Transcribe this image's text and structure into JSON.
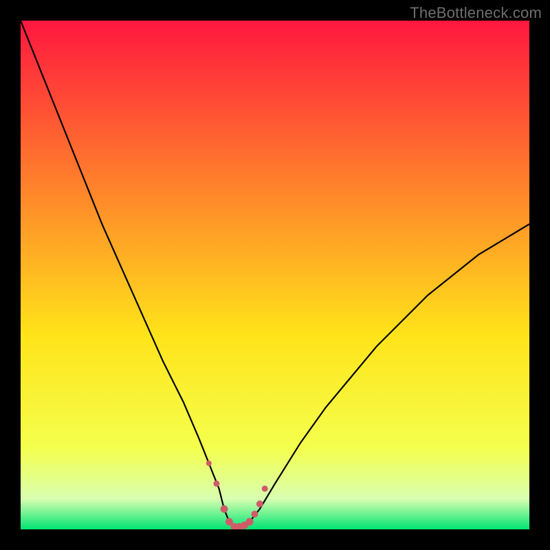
{
  "watermark": "TheBottleneck.com",
  "colors": {
    "frame": "#000000",
    "curve": "#000000",
    "marker": "#cf5b69",
    "grad_top": "#ff173f",
    "grad_mid_upper": "#ff8a2a",
    "grad_mid": "#ffe41a",
    "grad_mid_lower": "#f4ff4d",
    "grad_floor": "#d9ffb0",
    "grad_bottom": "#00e573"
  },
  "chart_data": {
    "type": "line",
    "title": "",
    "xlabel": "",
    "ylabel": "",
    "xlim": [
      0,
      100
    ],
    "ylim": [
      0,
      100
    ],
    "series": [
      {
        "name": "bottleneck-curve",
        "x": [
          0,
          4,
          8,
          12,
          16,
          20,
          24,
          28,
          32,
          35,
          37,
          39,
          40,
          41,
          42,
          43,
          44,
          45,
          47,
          50,
          55,
          60,
          65,
          70,
          75,
          80,
          85,
          90,
          95,
          100
        ],
        "values": [
          100,
          90,
          80,
          70,
          60,
          51,
          42,
          33,
          25,
          18,
          13,
          8,
          4,
          1.5,
          0.5,
          0.5,
          0.8,
          1.5,
          4,
          9,
          17,
          24,
          30,
          36,
          41,
          46,
          50,
          54,
          57,
          60
        ]
      }
    ],
    "markers": {
      "name": "valley-markers",
      "x": [
        37,
        38.5,
        40,
        41,
        42,
        43,
        44,
        45,
        46,
        47,
        48
      ],
      "values": [
        13,
        9,
        4,
        1.5,
        0.5,
        0.5,
        0.8,
        1.5,
        3,
        5,
        8
      ],
      "radius": [
        4,
        4.5,
        5.5,
        5.5,
        5.5,
        5.5,
        5.5,
        5.5,
        5,
        5,
        4.5
      ]
    }
  }
}
